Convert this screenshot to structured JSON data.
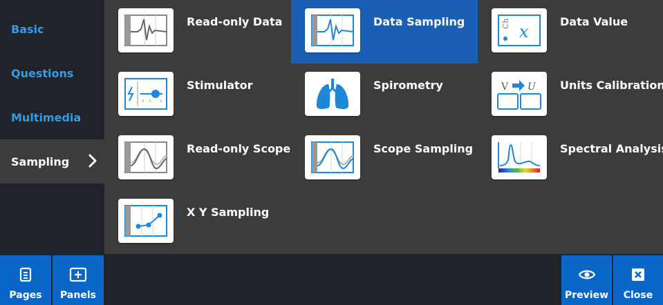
{
  "sidebar": {
    "items": [
      {
        "label": "Basic"
      },
      {
        "label": "Questions"
      },
      {
        "label": "Multimedia"
      },
      {
        "label": "Sampling",
        "active": true
      }
    ]
  },
  "panels": {
    "items": [
      {
        "label": "Read-only Data",
        "icon": "read-only-data-icon"
      },
      {
        "label": "Data Sampling",
        "icon": "data-sampling-icon",
        "selected": true
      },
      {
        "label": "Data Value",
        "icon": "data-value-icon"
      },
      {
        "label": "Stimulator",
        "icon": "stimulator-icon"
      },
      {
        "label": "Spirometry",
        "icon": "lungs-icon"
      },
      {
        "label": "Units Calibration",
        "icon": "units-calibration-icon"
      },
      {
        "label": "Read-only Scope",
        "icon": "read-only-scope-icon"
      },
      {
        "label": "Scope Sampling",
        "icon": "scope-sampling-icon"
      },
      {
        "label": "Spectral Analysis",
        "icon": "spectral-analysis-icon"
      },
      {
        "label": "X Y Sampling",
        "icon": "xy-sampling-icon"
      }
    ]
  },
  "icon_text": {
    "ch": "Ch",
    "x": "x",
    "v": "V",
    "u": "U"
  },
  "bottom": {
    "pages": "Pages",
    "panels": "Panels",
    "preview": "Preview",
    "close": "Close"
  },
  "colors": {
    "accent": "#0a66c9",
    "selected": "#1a5fb4",
    "sidebar_text": "#2e9fe6",
    "panel_bg": "#3c3c3c",
    "dark_bg": "#202329",
    "icon_blue": "#1e88d8"
  }
}
